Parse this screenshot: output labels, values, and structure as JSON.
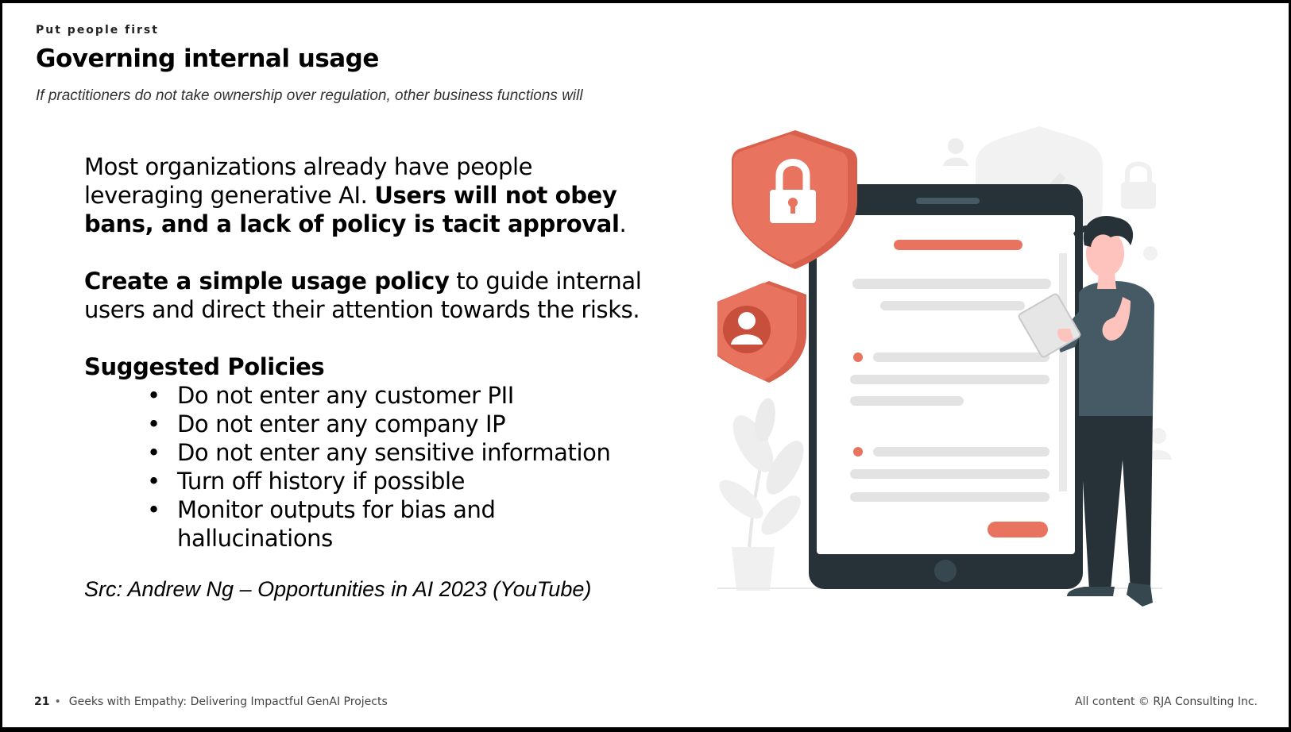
{
  "slide": {
    "kicker": "Put people first",
    "title": "Governing internal usage",
    "subtitle": "If practitioners do not take ownership over regulation, other business functions will"
  },
  "body": {
    "para1_start": "Most organizations already have people leveraging generative AI.  ",
    "para1_bold": "Users will not obey bans, and a lack of policy is tacit approval",
    "para1_end": ".",
    "para2_bold": "Create a simple usage policy",
    "para2_rest": " to guide internal users and direct their attention towards the risks.",
    "policies_heading": "Suggested Policies",
    "policies": [
      "Do not enter any customer PII",
      "Do not enter any company IP",
      "Do not enter any sensitive information",
      "Turn off history if possible",
      "Monitor outputs for bias and hallucinations"
    ],
    "source": "Src: Andrew Ng – Opportunities in AI 2023 (YouTube)"
  },
  "footer": {
    "page_number": "21",
    "separator": "•",
    "deck_title": "Geeks with Empathy: Delivering Impactful GenAI Projects",
    "copyright": "All content © RJA Consulting Inc."
  },
  "illustration": {
    "icons": [
      "shield-lock-icon",
      "shield-user-icon",
      "tablet",
      "person-holding-tablet",
      "plant"
    ],
    "colors": {
      "accent": "#e8735f",
      "dark": "#263238",
      "skeleton": "#e3e3e3",
      "light": "#f0f0f0"
    }
  }
}
